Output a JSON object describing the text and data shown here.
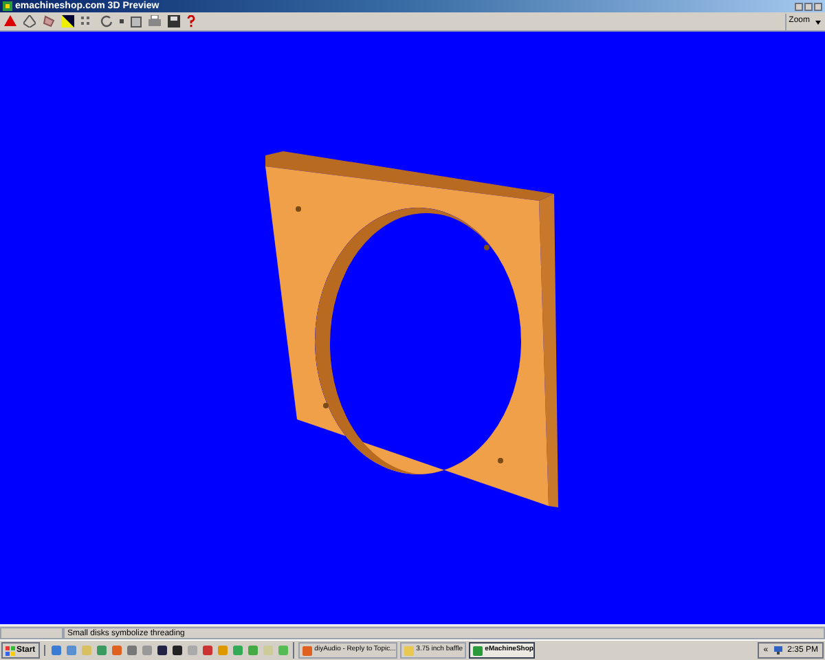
{
  "window": {
    "title": "emachineshop.com 3D Preview"
  },
  "toolbar": {
    "zoom": "Zoom"
  },
  "status_bar": {
    "text": "Small disks symbolize threading"
  },
  "taskbar": {
    "start": "Start",
    "tasks": [
      {
        "label": "diyAudio - Reply to Topic...",
        "selected": false,
        "kind": "browser"
      },
      {
        "label": "3.75 inch baffle",
        "selected": false,
        "kind": "folder"
      },
      {
        "label": "eMachineShop",
        "selected": true,
        "kind": "app"
      }
    ],
    "tray": {
      "expand": "«",
      "time": "2:35 PM"
    }
  }
}
